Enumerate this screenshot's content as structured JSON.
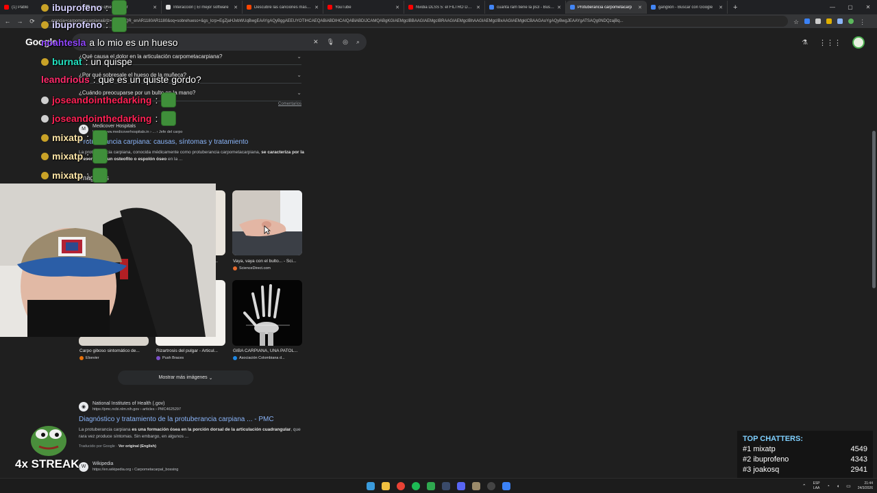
{
  "browser": {
    "tabs": [
      {
        "title": "(1) Pablo",
        "color": "#ff0000",
        "active": false
      },
      {
        "title": "s que quieren morir",
        "color": "#9aa0a6",
        "active": false
      },
      {
        "title": "Interacción | El mejor software",
        "color": "#e0e0e0",
        "active": false
      },
      {
        "title": "Descubre las canciones más es",
        "color": "#ff4500",
        "active": false
      },
      {
        "title": "YouTube",
        "color": "#ff0000",
        "active": false
      },
      {
        "title": "Nvidia DLSS 5: el FILTRO DE IA",
        "color": "#ff0000",
        "active": false
      },
      {
        "title": "cuanta ram tiene la ps3 - Busca",
        "color": "#4285f4",
        "active": false
      },
      {
        "title": "Protuberancia carpometacarp",
        "color": "#4285f4",
        "active": true
      },
      {
        "title": "ganglión - Buscar con Google",
        "color": "#4285f4",
        "active": false
      }
    ],
    "url": "...erancia+carpometacarpiana&rlz=1C1RXQR_enAR1180AR1180&oq=sobrehueso+&gs_lcrp=EgZjaHJvbWUqBwgEAAYgAQyBggAEEUYOTIHCAEQABiABDIHCAIQABiABDIJCAMQABgKGIAEMgcIBBAAGIAEMgcIBRAAGIAEMgcIBhAAGIAEMgcIBxAAGIAEMgkICBAAGAoYgAQyBwgJEAAYgATSAQg0NDQzajBq..."
  },
  "google": {
    "logo": "Google",
    "search_value": "",
    "paa": [
      {
        "q": "¿Qué causa el dolor en la articulación carpometacarpiana?"
      },
      {
        "q": "¿Por qué sobresale el hueso de la muñeca?"
      },
      {
        "q": "¿Cuándo preocuparse por un bulto en la mano?"
      }
    ],
    "feedback": "Comentarios",
    "result1": {
      "site": "Medicover Hospitals",
      "url": "https://www.medicoverhospitals.in › ... › Jefe del carpo",
      "title": "Protuberancia carpiana: causas, síntomas y tratamiento",
      "snippet_a": "La protuberancia carpiana, conocida médicamente como protuberancia carpometacarpiana, ",
      "snippet_b": "se caracteriza por la presencia de un osteofito o espolón óseo",
      "snippet_c": " en la ..."
    },
    "images_heading": "Imágenes",
    "images": [
      {
        "caption": "Vaya, vaya con el bulto... - Sci...",
        "source": "ScienceDirect.com",
        "color": "#e66b2e"
      },
      {
        "caption": "Carpo giboso sintomático de...",
        "source": "Elsevier",
        "color": "#e8710a"
      },
      {
        "caption": "Rizartrosis del pulgar - Articul...",
        "source": "Push Braces",
        "color": "#7b4fc9"
      },
      {
        "caption": "GIBA CARPIANA, UNA PATOL...",
        "source": "Asociación Colombiana d...",
        "color": "#1e88e5"
      }
    ],
    "images_partial_caption": "...: 7...",
    "more_images": "Mostrar más imágenes",
    "result2": {
      "site": "National Institutes of Health (.gov)",
      "url": "https://pmc.ncbi.nlm.nih.gov › articles › PMC4625297",
      "title": "Diagnóstico y tratamiento de la protuberancia carpiana ... - PMC",
      "snippet_a": "La protuberancia carpiana ",
      "snippet_b": "es una formación ósea en la porción dorsal de la articulación cuadrangular",
      "snippet_c": ", que rara vez produce síntomas. Sin embargo, en algunos ...",
      "translated": "Traducido por Google · ",
      "original": "Ver original (English)"
    },
    "result3": {
      "site": "Wikipedia",
      "url": "https://en.wikipedia.org › Carpometacarpal_bossing"
    }
  },
  "overlay": {
    "chat": [
      {
        "user": "ibuprofeno",
        "color": "#d6d1ff",
        "badge": "gold",
        "msg": ":",
        "emote": true
      },
      {
        "user": "ibuprofeno",
        "color": "#d6d1ff",
        "badge": "gold",
        "msg": ":",
        "emote": true
      },
      {
        "user": "noahtesla",
        "color": "#9146ff",
        "badge": "none",
        "msg": "a lo mio es un hueso",
        "emote": false
      },
      {
        "user": "burnat",
        "color": "#22e3c2",
        "badge": "gold",
        "msg": ": un quispe",
        "emote": false
      },
      {
        "user": "leandrious",
        "color": "#ff2b6b",
        "badge": "none",
        "msg": ": que es un quiste gordo?",
        "emote": false
      },
      {
        "user": "joseandointhedarking",
        "color": "#ff2255",
        "badge": "gray",
        "msg": ":",
        "emote": true
      },
      {
        "user": "joseandointhedarking",
        "color": "#ff2255",
        "badge": "gray",
        "msg": ":",
        "emote": true
      },
      {
        "user": "mixatp",
        "color": "#ffe7a8",
        "badge": "gold",
        "msg": ":",
        "emote": true
      },
      {
        "user": "mixatp",
        "color": "#ffe7a8",
        "badge": "gold",
        "msg": ":",
        "emote": true
      },
      {
        "user": "mixatp",
        "color": "#ffe7a8",
        "badge": "gold",
        "msg": ":",
        "emote": true
      }
    ],
    "top_chatters": {
      "title": "TOP CHATTERS:",
      "rows": [
        {
          "rank": "#1",
          "name": "mixatp",
          "count": "4549"
        },
        {
          "rank": "#2",
          "name": "ibuprofeno",
          "count": "4343"
        },
        {
          "rank": "#3",
          "name": "joakosq",
          "count": "2941"
        }
      ]
    },
    "streak": "4x STREAK"
  },
  "taskbar": {
    "lang": "LAA",
    "lang_top": "ESP",
    "time": "21:44",
    "date": "24/3/2026"
  }
}
